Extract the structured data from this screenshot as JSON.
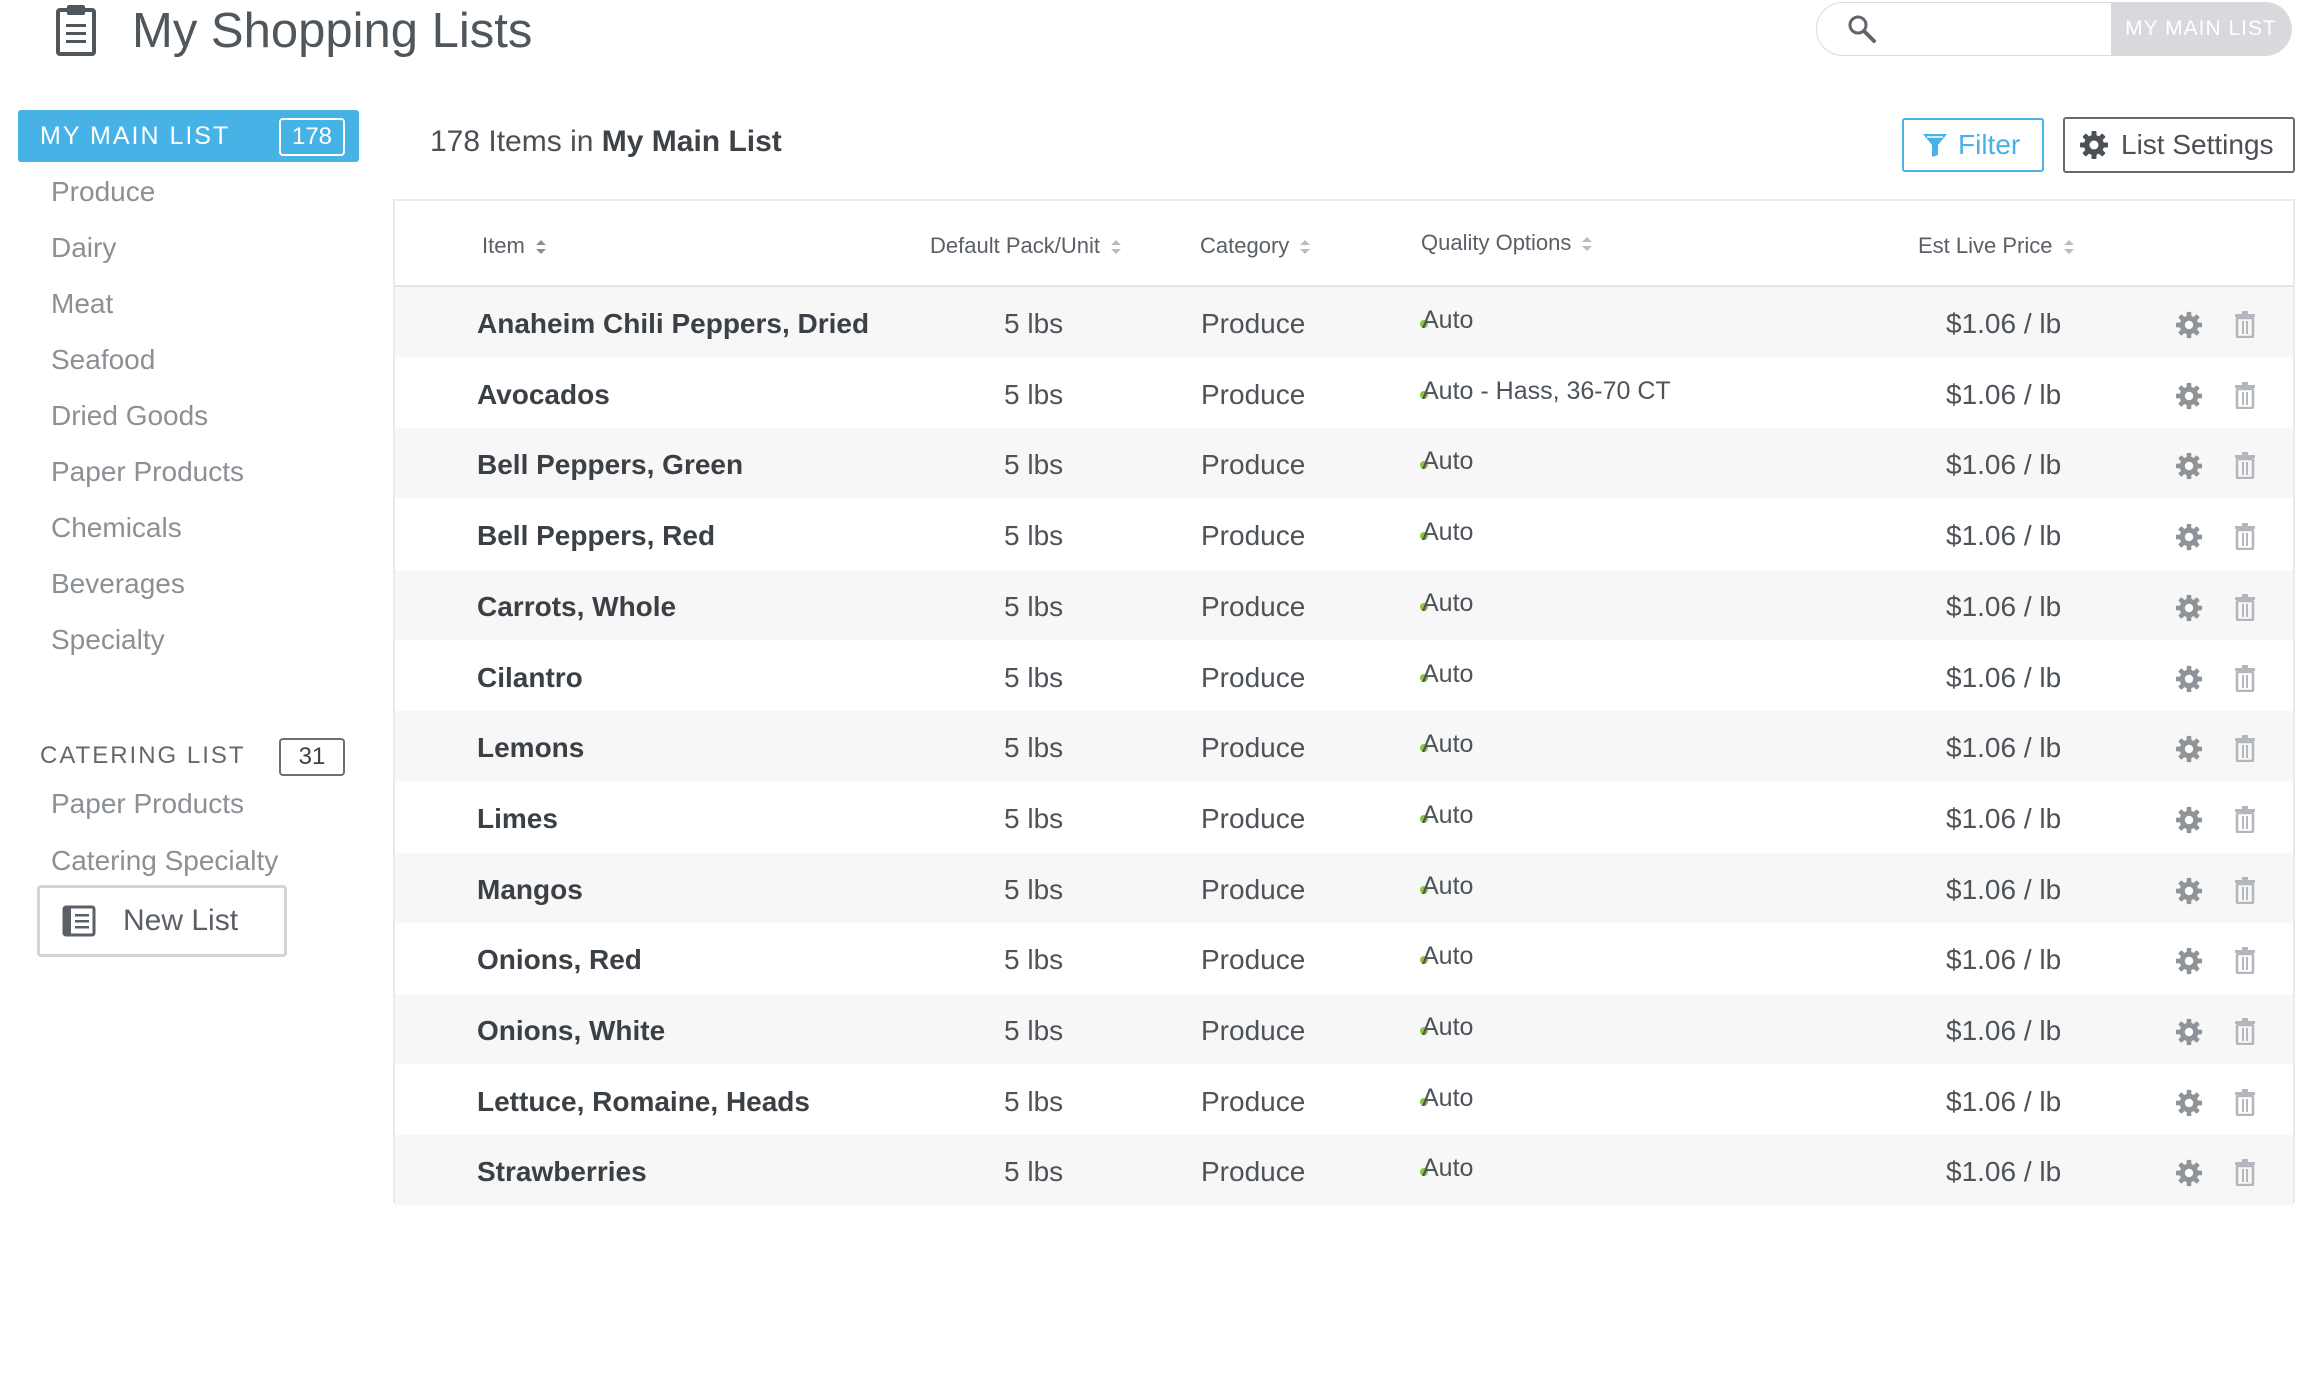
{
  "header": {
    "title": "My Shopping Lists",
    "search_placeholder": "",
    "search_scope": "MY MAIN LIST"
  },
  "sidebar": {
    "lists": [
      {
        "name": "MY MAIN LIST",
        "count": "178",
        "active": true,
        "categories": [
          "Produce",
          "Dairy",
          "Meat",
          "Seafood",
          "Dried Goods",
          "Paper Products",
          "Chemicals",
          "Beverages",
          "Specialty"
        ]
      },
      {
        "name": "CATERING LIST",
        "count": "31",
        "active": false,
        "categories": [
          "Paper Products",
          "Catering Specialty"
        ]
      }
    ],
    "new_list_label": "New List"
  },
  "main": {
    "count_text": "178 Items in",
    "list_name": "My Main List",
    "filter_label": "Filter",
    "settings_label": "List Settings"
  },
  "table": {
    "columns": [
      "Item",
      "Default Pack/Unit",
      "Category",
      "Quality Options",
      "Est Live Price"
    ],
    "rows": [
      {
        "item": "Anaheim Chili Peppers, Dried",
        "pack": "5 lbs",
        "category": "Produce",
        "quality": "Auto",
        "price": "$1.06 / lb"
      },
      {
        "item": "Avocados",
        "pack": "5 lbs",
        "category": "Produce",
        "quality": "Auto  -  Hass, 36-70 CT",
        "price": "$1.06 / lb"
      },
      {
        "item": "Bell Peppers, Green",
        "pack": "5 lbs",
        "category": "Produce",
        "quality": "Auto",
        "price": "$1.06 / lb"
      },
      {
        "item": "Bell Peppers, Red",
        "pack": "5 lbs",
        "category": "Produce",
        "quality": "Auto",
        "price": "$1.06 / lb"
      },
      {
        "item": "Carrots, Whole",
        "pack": "5 lbs",
        "category": "Produce",
        "quality": "Auto",
        "price": "$1.06 / lb"
      },
      {
        "item": "Cilantro",
        "pack": "5 lbs",
        "category": "Produce",
        "quality": "Auto",
        "price": "$1.06 / lb"
      },
      {
        "item": "Lemons",
        "pack": "5 lbs",
        "category": "Produce",
        "quality": "Auto",
        "price": "$1.06 / lb"
      },
      {
        "item": "Limes",
        "pack": "5 lbs",
        "category": "Produce",
        "quality": "Auto",
        "price": "$1.06 / lb"
      },
      {
        "item": "Mangos",
        "pack": "5 lbs",
        "category": "Produce",
        "quality": "Auto",
        "price": "$1.06 / lb"
      },
      {
        "item": "Onions, Red",
        "pack": "5 lbs",
        "category": "Produce",
        "quality": "Auto",
        "price": "$1.06 / lb"
      },
      {
        "item": "Onions, White",
        "pack": "5 lbs",
        "category": "Produce",
        "quality": "Auto",
        "price": "$1.06 / lb"
      },
      {
        "item": "Lettuce, Romaine, Heads",
        "pack": "5 lbs",
        "category": "Produce",
        "quality": "Auto",
        "price": "$1.06 / lb"
      },
      {
        "item": "Strawberries",
        "pack": "5 lbs",
        "category": "Produce",
        "quality": "Auto",
        "price": "$1.06 / lb"
      }
    ]
  },
  "colors": {
    "accent": "#46b2e6",
    "quality_dot": "#8cc63f",
    "row_alt": "#f7f7f7"
  },
  "icons": {
    "header": "clipboard-icon",
    "search": "search-icon",
    "filter": "funnel-icon",
    "settings": "gear-icon",
    "new_list": "book-icon",
    "row_actions": [
      "gear-icon",
      "trash-icon"
    ]
  }
}
